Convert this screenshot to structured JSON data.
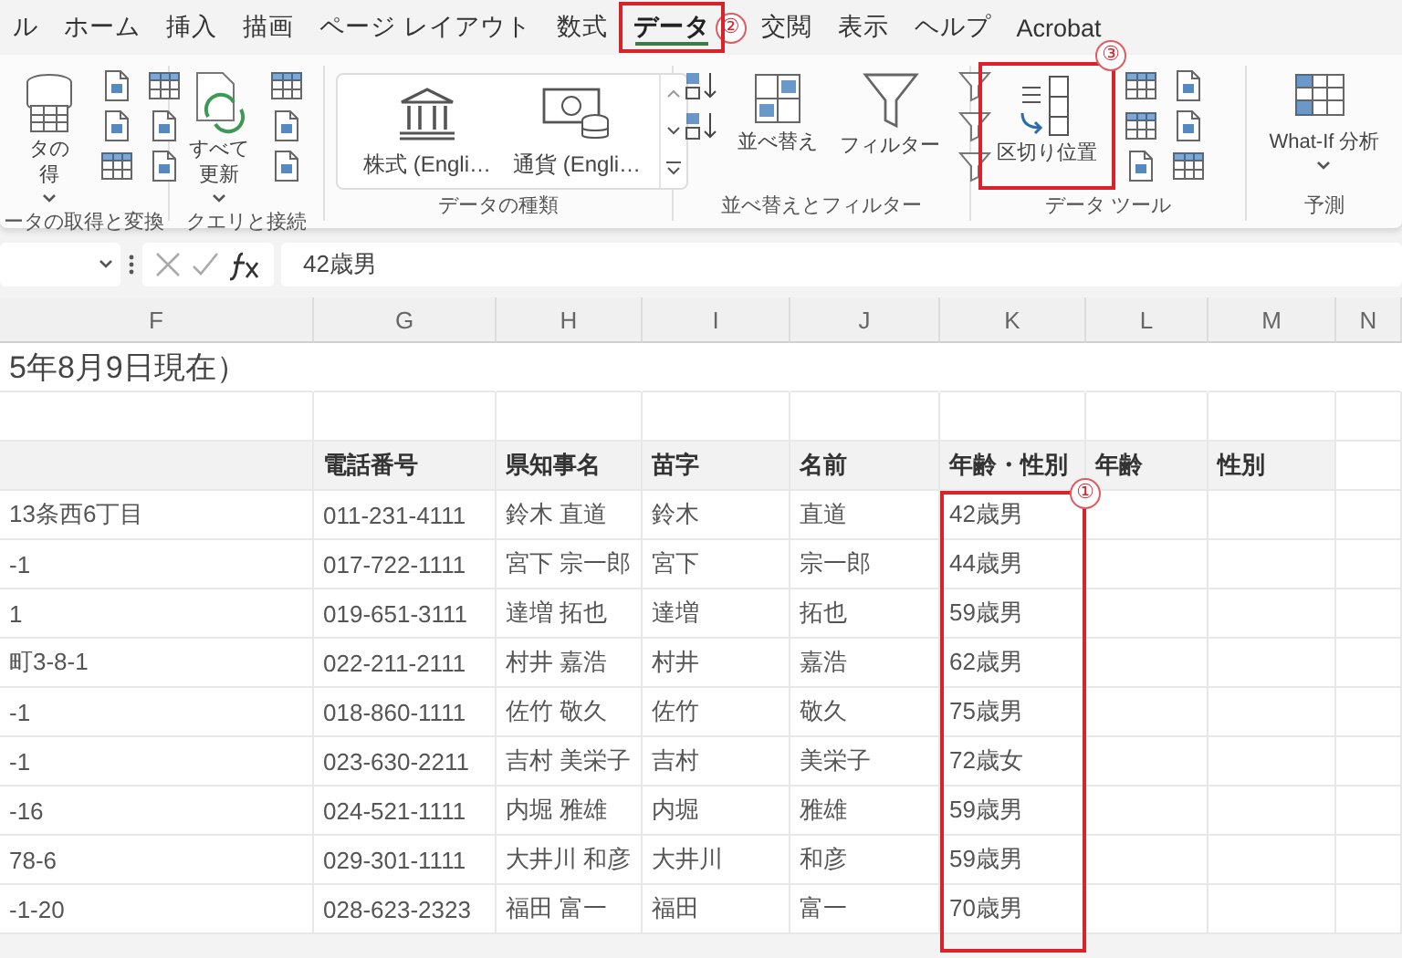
{
  "tabs": [
    {
      "label": "ル",
      "selected": false
    },
    {
      "label": "ホーム",
      "selected": false
    },
    {
      "label": "挿入",
      "selected": false
    },
    {
      "label": "描画",
      "selected": false
    },
    {
      "label": "ページ レイアウト",
      "selected": false
    },
    {
      "label": "数式",
      "selected": false
    },
    {
      "label": "データ",
      "selected": true,
      "callout": "②"
    },
    {
      "label": "交閲",
      "selected": false
    },
    {
      "label": "表示",
      "selected": false
    },
    {
      "label": "ヘルプ",
      "selected": false
    },
    {
      "label": "Acrobat",
      "selected": false
    }
  ],
  "ribbon": [
    {
      "label": "ータの取得と変換",
      "items": [
        {
          "kind": "large",
          "lines": [
            "タの",
            "得"
          ],
          "menu": true
        },
        {
          "kind": "icon-column",
          "icons": [
            {
              "kind": "doc"
            },
            {
              "kind": "doc"
            },
            {
              "kind": "table"
            }
          ]
        },
        {
          "kind": "icon-column",
          "icons": [
            {
              "kind": "table"
            },
            {
              "kind": "doc"
            },
            {
              "kind": "doc"
            }
          ]
        }
      ]
    },
    {
      "label": "クエリと接続",
      "items": [
        {
          "kind": "large",
          "lines": [
            "すべて",
            "更新"
          ],
          "menu": true
        },
        {
          "kind": "icon-column",
          "icons": [
            {
              "kind": "table"
            },
            {
              "kind": "doc"
            },
            {
              "kind": "doc"
            }
          ]
        }
      ]
    },
    {
      "label": "データの種類",
      "items": [
        {
          "kind": "gallery",
          "entries": [
            {
              "label": "株式 (Engli…"
            },
            {
              "label": "通貨 (Engli…"
            }
          ]
        }
      ]
    },
    {
      "label": "並べ替えとフィルター",
      "items": [
        {
          "kind": "icon-column",
          "icons": [
            {
              "kind": "sort"
            },
            {
              "kind": "sort"
            }
          ]
        },
        {
          "kind": "large",
          "lines": [
            "並べ替え"
          ]
        },
        {
          "kind": "large",
          "lines": [
            "フィルター"
          ]
        },
        {
          "kind": "icon-column",
          "icons": [
            {
              "kind": "funnel"
            },
            {
              "kind": "funnel"
            },
            {
              "kind": "funnel"
            }
          ]
        }
      ]
    },
    {
      "label": "データ ツール",
      "items": [
        {
          "kind": "large",
          "lines": [
            "区切り位置"
          ],
          "callout": "③"
        },
        {
          "kind": "icon-column",
          "icons": [
            {
              "kind": "table"
            },
            {
              "kind": "table"
            },
            {
              "kind": "doc"
            }
          ]
        },
        {
          "kind": "icon-column",
          "icons": [
            {
              "kind": "doc"
            },
            {
              "kind": "doc"
            },
            {
              "kind": "table"
            }
          ]
        }
      ]
    },
    {
      "label": "予測",
      "items": [
        {
          "kind": "large",
          "lines": [
            "What-If 分析"
          ],
          "menu": true
        }
      ]
    }
  ],
  "formula_bar": {
    "value": "42歳男"
  },
  "sheet": {
    "columns": [
      {
        "label": "F",
        "highlighted": false
      },
      {
        "label": "G",
        "highlighted": false
      },
      {
        "label": "H",
        "highlighted": false
      },
      {
        "label": "I",
        "highlighted": false
      },
      {
        "label": "J",
        "highlighted": false
      },
      {
        "label": "K",
        "highlighted": true,
        "callout": "①"
      },
      {
        "label": "L",
        "highlighted": false
      },
      {
        "label": "M",
        "highlighted": false
      },
      {
        "label": "N",
        "highlighted": false
      }
    ],
    "rows": [
      {
        "kind": "title",
        "F": "5年8月9日現在）"
      },
      {
        "kind": "blank"
      },
      {
        "kind": "header",
        "G": "電話番号",
        "H": "県知事名",
        "I": "苗字",
        "J": "名前",
        "K": "年齢・性別",
        "L": "年齢",
        "M": "性別"
      },
      {
        "kind": "data",
        "F": "13条西6丁目",
        "G": "011-231-4111",
        "H": "鈴木 直道",
        "I": "鈴木",
        "J": "直道",
        "K": "42歳男"
      },
      {
        "kind": "data",
        "F": "-1",
        "G": "017-722-1111",
        "H": "宮下 宗一郎",
        "I": "宮下",
        "J": "宗一郎",
        "K": "44歳男"
      },
      {
        "kind": "data",
        "F": "1",
        "G": "019-651-3111",
        "H": "達増 拓也",
        "I": "達増",
        "J": "拓也",
        "K": "59歳男"
      },
      {
        "kind": "data",
        "F": "町3-8-1",
        "G": "022-211-2111",
        "H": "村井 嘉浩",
        "I": "村井",
        "J": "嘉浩",
        "K": "62歳男"
      },
      {
        "kind": "data",
        "F": "-1",
        "G": "018-860-1111",
        "H": "佐竹 敬久",
        "I": "佐竹",
        "J": "敬久",
        "K": "75歳男"
      },
      {
        "kind": "data",
        "F": "-1",
        "G": "023-630-2211",
        "H": "吉村 美栄子",
        "I": "吉村",
        "J": "美栄子",
        "K": "72歳女"
      },
      {
        "kind": "data",
        "F": "-16",
        "G": "024-521-1111",
        "H": "内堀 雅雄",
        "I": "内堀",
        "J": "雅雄",
        "K": "59歳男"
      },
      {
        "kind": "data",
        "F": "78-6",
        "G": "029-301-1111",
        "H": "大井川 和彦",
        "I": "大井川",
        "J": "和彦",
        "K": "59歳男"
      },
      {
        "kind": "data",
        "F": "-1-20",
        "G": "028-623-2323",
        "H": "福田 富一",
        "I": "福田",
        "J": "富一",
        "K": "70歳男"
      }
    ]
  }
}
